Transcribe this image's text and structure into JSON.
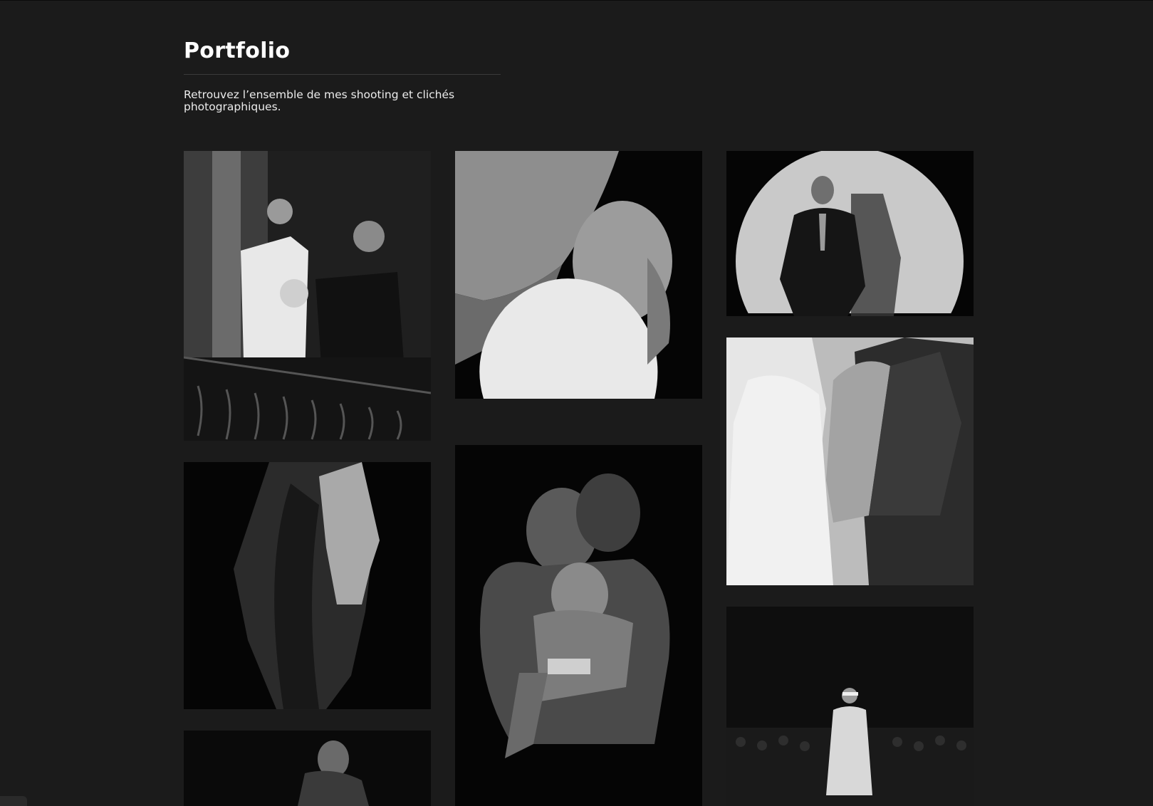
{
  "header": {
    "title": "Portfolio",
    "description": "Retrouvez l’ensemble de mes shooting et clichés photographiques."
  },
  "gallery": [
    {
      "subject": "wedding couple on balcony"
    },
    {
      "subject": "father holding newborn"
    },
    {
      "subject": "woman in spotlight circle"
    },
    {
      "subject": "woman profile portrait"
    },
    {
      "subject": "family embracing baby"
    },
    {
      "subject": "bride and groom back view"
    },
    {
      "subject": "woman portrait"
    },
    {
      "subject": "runway fashion show"
    }
  ]
}
